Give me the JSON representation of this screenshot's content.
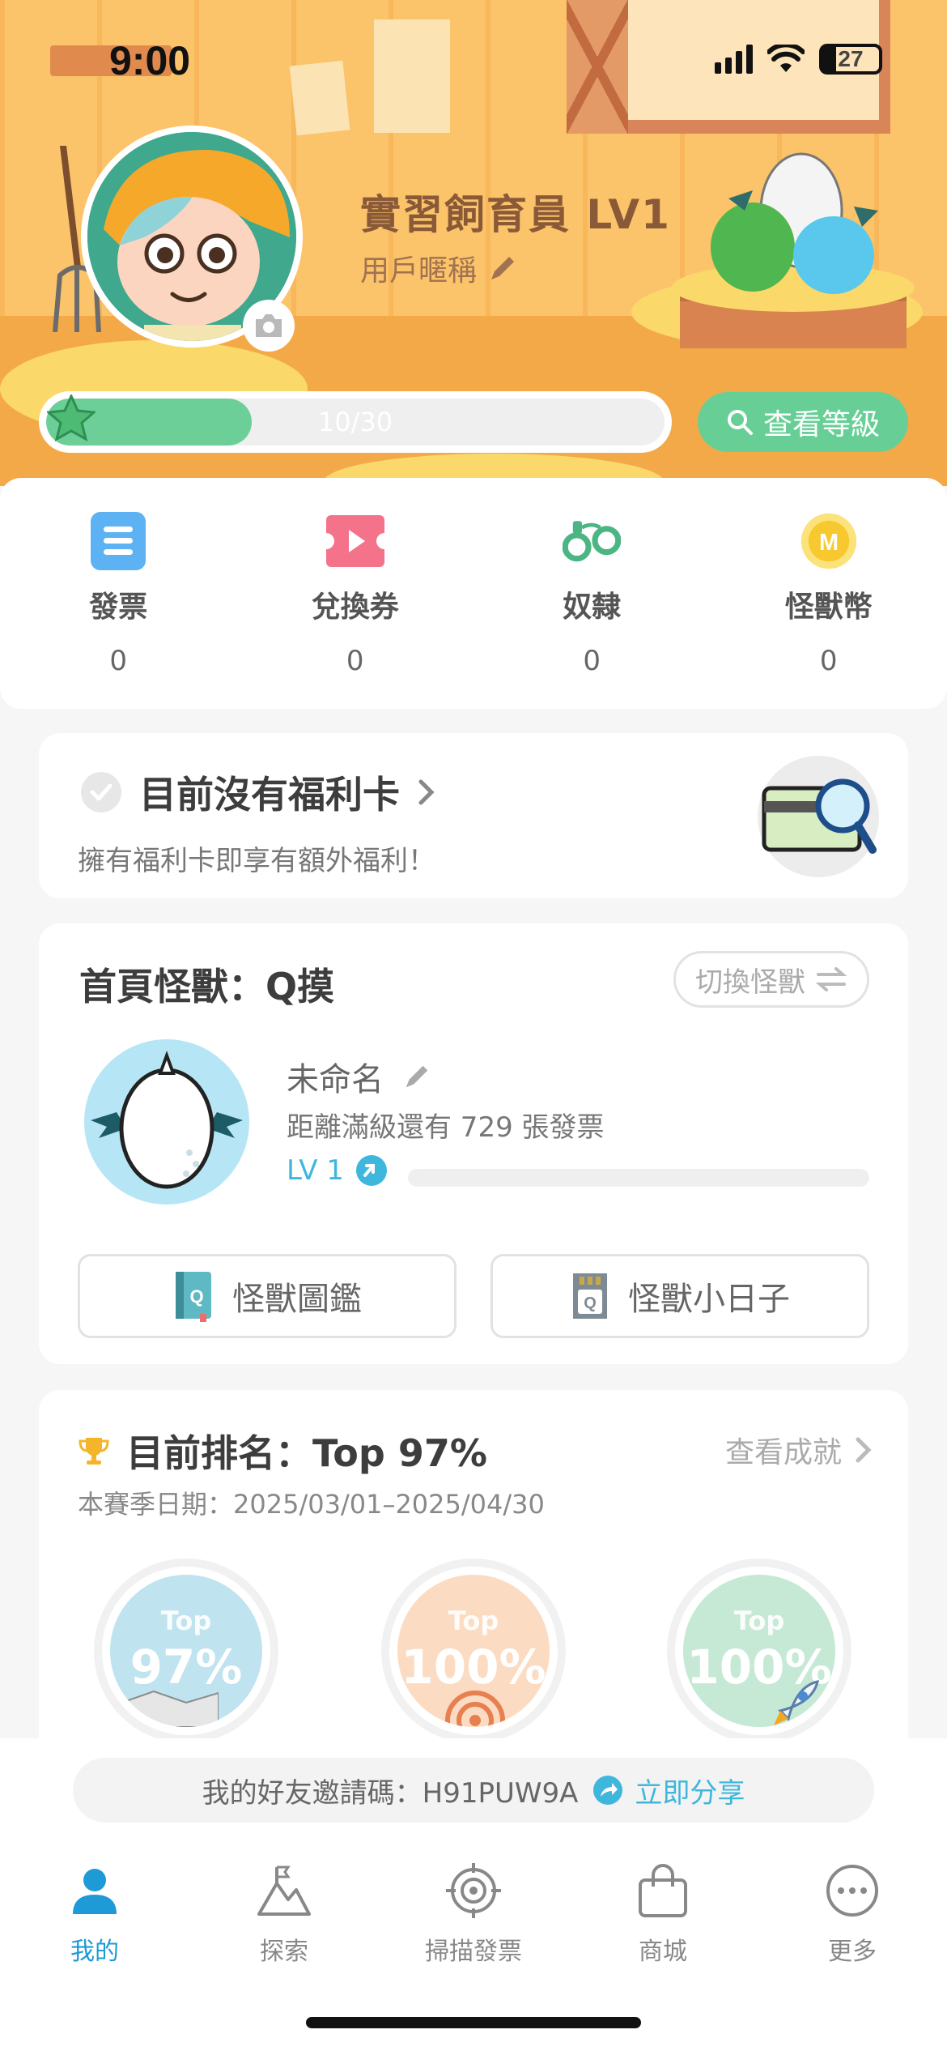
{
  "status": {
    "time": "9:00",
    "battery": "27"
  },
  "profile": {
    "title": "實習飼育員 LV1",
    "nickname": "用戶暱稱",
    "progress_text": "10/30",
    "progress_value": 0.333,
    "level_button": "查看等級"
  },
  "stats": [
    {
      "label": "發票",
      "value": "0",
      "icon": "list-icon",
      "color": "#5db2f3"
    },
    {
      "label": "兌換券",
      "value": "0",
      "icon": "play-ticket-icon",
      "color": "#f4728a"
    },
    {
      "label": "奴隸",
      "value": "0",
      "icon": "handcuffs-icon",
      "color": "#4bb583"
    },
    {
      "label": "怪獸幣",
      "value": "0",
      "icon": "coin-icon",
      "color": "#f7c92f"
    }
  ],
  "welfare": {
    "title": "目前沒有福利卡",
    "subtitle": "擁有福利卡即享有額外福利！"
  },
  "monster": {
    "title": "首頁怪獸：Q摸",
    "switch_label": "切換怪獸",
    "name": "未命名",
    "remaining": "距離滿級還有 729 張發票",
    "level": "LV 1",
    "level_progress": 0.0,
    "button_book": "怪獸圖鑑",
    "button_diary": "怪獸小日子"
  },
  "ranking": {
    "title": "目前排名：Top 97%",
    "view_label": "查看成就",
    "season": "本賽季日期：2025/03/01–2025/04/30",
    "rings": [
      {
        "top": "Top",
        "value": "97%",
        "color": "#bfe3ef"
      },
      {
        "top": "Top",
        "value": "100%",
        "color": "#fbdcc3"
      },
      {
        "top": "Top",
        "value": "100%",
        "color": "#c6e9d5"
      }
    ]
  },
  "invite": {
    "text": "我的好友邀請碼：H91PUW9A",
    "share_label": "立即分享"
  },
  "nav": [
    {
      "label": "我的",
      "icon": "person-icon",
      "active": true
    },
    {
      "label": "探索",
      "icon": "mountain-flag-icon",
      "active": false
    },
    {
      "label": "掃描發票",
      "icon": "target-icon",
      "active": false
    },
    {
      "label": "商城",
      "icon": "shopping-bag-icon",
      "active": false
    },
    {
      "label": "更多",
      "icon": "more-dots-icon",
      "active": false
    }
  ]
}
